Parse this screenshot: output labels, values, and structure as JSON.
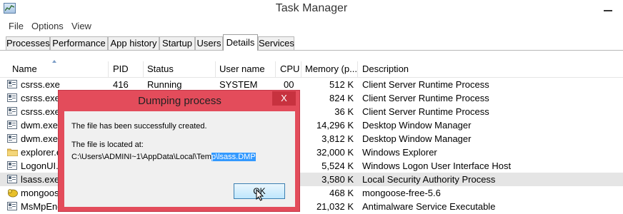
{
  "window": {
    "title": "Task Manager"
  },
  "menu": [
    "File",
    "Options",
    "View"
  ],
  "tabs": [
    "Processes",
    "Performance",
    "App history",
    "Startup",
    "Users",
    "Details",
    "Services"
  ],
  "active_tab": "Details",
  "columns": [
    "Name",
    "PID",
    "Status",
    "User name",
    "CPU",
    "Memory (p...",
    "Description"
  ],
  "rows": [
    {
      "name": "csrss.exe",
      "pid": "416",
      "status": "Running",
      "user": "SYSTEM",
      "cpu": "00",
      "memory": "512 K",
      "description": "Client Server Runtime Process",
      "icon": "process-icon"
    },
    {
      "name": "csrss.exe",
      "pid": "",
      "status": "",
      "user": "",
      "cpu": "",
      "memory": "824 K",
      "description": "Client Server Runtime Process",
      "icon": "process-icon"
    },
    {
      "name": "csrss.exe",
      "pid": "",
      "status": "",
      "user": "",
      "cpu": "",
      "memory": "36 K",
      "description": "Client Server Runtime Process",
      "icon": "process-icon"
    },
    {
      "name": "dwm.exe",
      "pid": "",
      "status": "",
      "user": "",
      "cpu": "",
      "memory": "14,296 K",
      "description": "Desktop Window Manager",
      "icon": "process-icon"
    },
    {
      "name": "dwm.exe",
      "pid": "",
      "status": "",
      "user": "",
      "cpu": "",
      "memory": "3,812 K",
      "description": "Desktop Window Manager",
      "icon": "process-icon"
    },
    {
      "name": "explorer.e",
      "pid": "",
      "status": "",
      "user": "",
      "cpu": "",
      "memory": "32,000 K",
      "description": "Windows Explorer",
      "icon": "folder-icon"
    },
    {
      "name": "LogonUI.e",
      "pid": "",
      "status": "",
      "user": "",
      "cpu": "",
      "memory": "5,524 K",
      "description": "Windows Logon User Interface Host",
      "icon": "process-icon"
    },
    {
      "name": "lsass.exe",
      "pid": "",
      "status": "",
      "user": "",
      "cpu": "",
      "memory": "3,580 K",
      "description": "Local Security Authority Process",
      "icon": "process-icon",
      "selected": true
    },
    {
      "name": "mongoos",
      "pid": "",
      "status": "",
      "user": "",
      "cpu": "",
      "memory": "468 K",
      "description": "mongoose-free-5.6",
      "icon": "mongoose-icon"
    },
    {
      "name": "MsMpEng",
      "pid": "",
      "status": "",
      "user": "",
      "cpu": "",
      "memory": "21,032 K",
      "description": "Antimalware Service Executable",
      "icon": "process-icon"
    }
  ],
  "dialog": {
    "title": "Dumping process",
    "close_label": "X",
    "message": "The file has been successfully created.",
    "location_label": "The file is located at:",
    "path_prefix": "C:\\Users\\ADMINI~1\\AppData\\Local\\Tem",
    "path_selected": "p\\lsass.DMP",
    "ok_label": "OK"
  }
}
